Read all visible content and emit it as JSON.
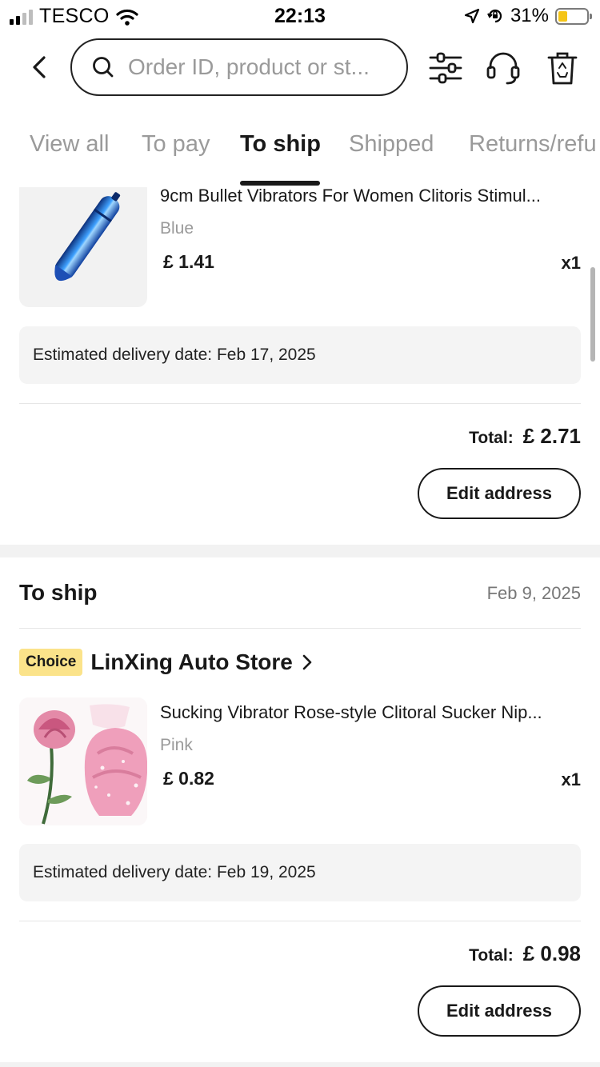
{
  "status_bar": {
    "carrier": "TESCO",
    "time": "22:13",
    "battery_percent": "31%",
    "battery_level": 0.31,
    "battery_color": "#f5c518",
    "icons": [
      "cellular-signal-icon",
      "wifi-icon",
      "location-arrow-icon",
      "orientation-lock-icon",
      "battery-icon"
    ]
  },
  "header": {
    "search_placeholder": "Order ID, product or st...",
    "icons": [
      "back-chevron-icon",
      "search-icon",
      "filter-sliders-icon",
      "headset-icon",
      "recycle-bin-icon"
    ]
  },
  "tabs": [
    {
      "label": "View all",
      "active": false
    },
    {
      "label": "To pay",
      "active": false
    },
    {
      "label": "To ship",
      "active": true
    },
    {
      "label": "Shipped",
      "active": false
    },
    {
      "label": "Returns/refu",
      "active": false
    }
  ],
  "orders": [
    {
      "item": {
        "title": "9cm Bullet Vibrators For Women Clitoris Stimul...",
        "variant": "Blue",
        "price": "£ 1.41",
        "qty": "x1",
        "image_color": "#1f5fc8"
      },
      "delivery": "Estimated delivery date: Feb 17, 2025",
      "total_label": "Total:",
      "total_value": "£ 2.71",
      "action": "Edit address"
    },
    {
      "status": "To ship",
      "date": "Feb 9, 2025",
      "badge": "Choice",
      "store": "LinXing Auto Store",
      "item": {
        "title": "Sucking Vibrator Rose-style Clitoral Sucker Nip...",
        "variant": "Pink",
        "price": "£ 0.82",
        "qty": "x1",
        "image_color": "#e9a0b6"
      },
      "delivery": "Estimated delivery date: Feb 19, 2025",
      "total_label": "Total:",
      "total_value": "£ 0.98",
      "action": "Edit address"
    }
  ]
}
